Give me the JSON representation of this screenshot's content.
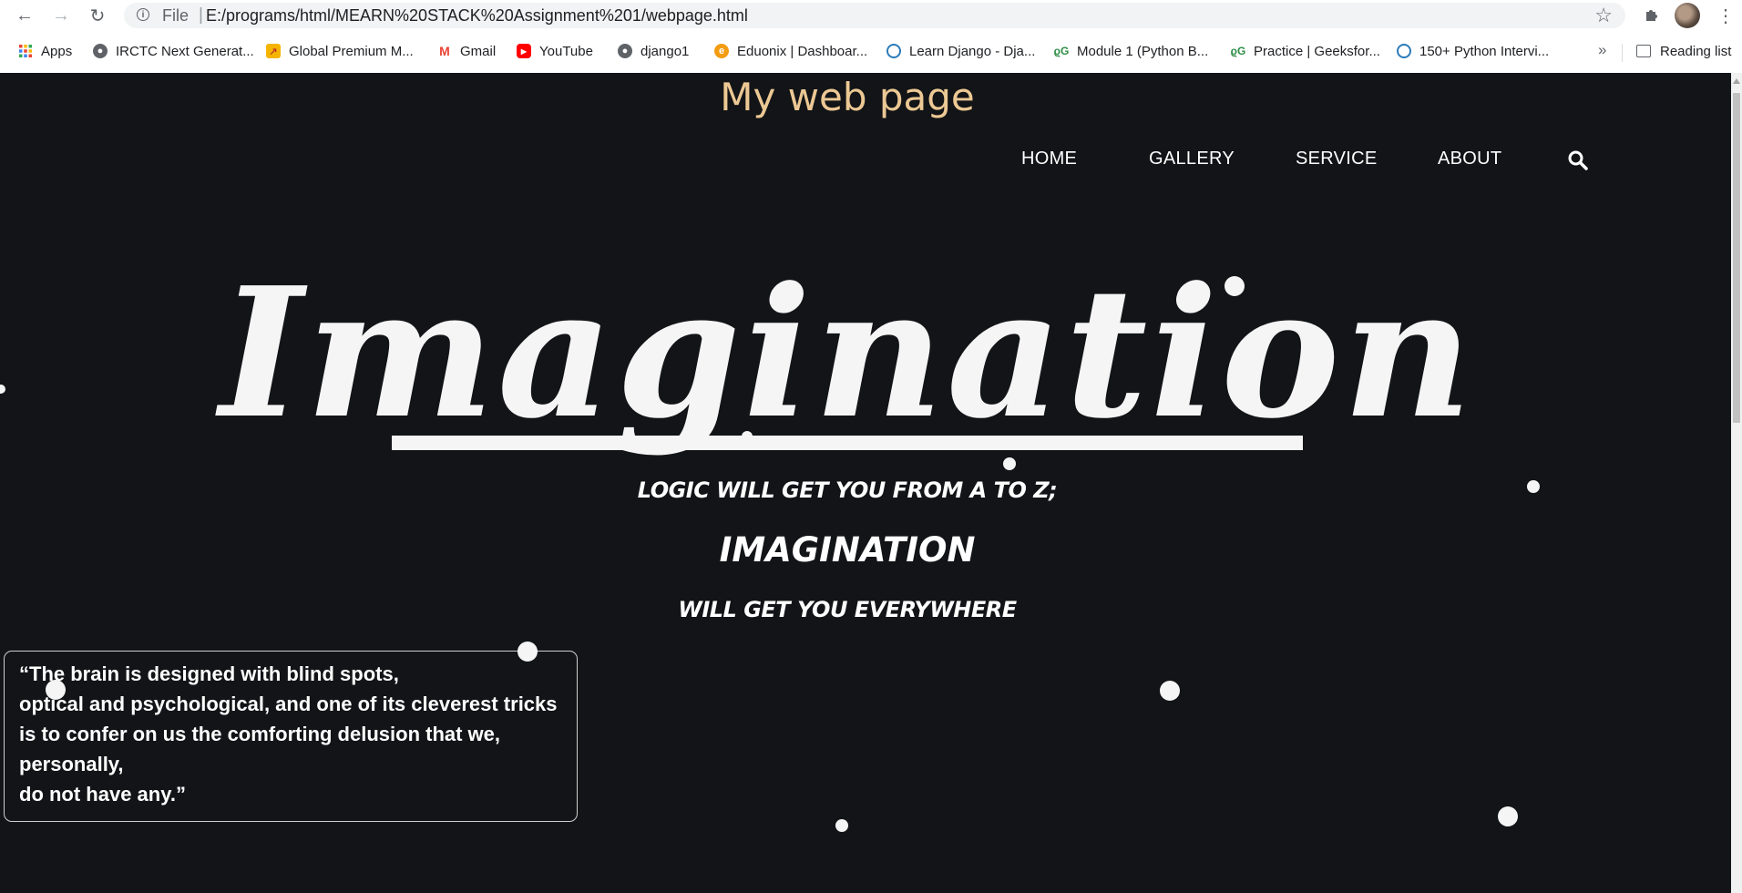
{
  "browser": {
    "file_label": "File",
    "url": "E:/programs/html/MEARN%20STACK%20Assignment%201/webpage.html",
    "bookmarks": [
      {
        "label": "Apps",
        "icon": "apps-grid-icon"
      },
      {
        "label": "IRCTC Next Generat...",
        "icon": "globe-icon"
      },
      {
        "label": "Global Premium M...",
        "icon": "global-premium-icon"
      },
      {
        "label": "Gmail",
        "icon": "gmail-icon"
      },
      {
        "label": "YouTube",
        "icon": "youtube-icon"
      },
      {
        "label": "django1",
        "icon": "globe-icon"
      },
      {
        "label": "Eduonix | Dashboar...",
        "icon": "eduonix-icon"
      },
      {
        "label": "Learn Django - Dja...",
        "icon": "django-icon"
      },
      {
        "label": "Module 1 (Python B...",
        "icon": "geeksforgeeks-icon"
      },
      {
        "label": "Practice | Geeksfor...",
        "icon": "geeksforgeeks-icon"
      },
      {
        "label": "150+ Python Intervi...",
        "icon": "django-icon"
      }
    ],
    "more_label": "»",
    "reading_list": "Reading list"
  },
  "site": {
    "title": "My web page",
    "nav": [
      {
        "label": "HOME"
      },
      {
        "label": "GALLERY"
      },
      {
        "label": "SERVICE"
      },
      {
        "label": "ABOUT"
      }
    ],
    "hero": "Imagination",
    "tagline1": "LOGIC WILL GET YOU FROM A TO Z;",
    "tagline2": "IMAGINATION",
    "tagline3": "WILL GET YOU EVERYWHERE",
    "quote": "“The brain is designed with blind spots,\noptical and psychological, and one of its cleverest tricks is to confer on us the comforting delusion that we, personally,\ndo not have any.”"
  },
  "colors": {
    "page_background": "#121417",
    "title_color": "#ecc894",
    "text_color": "#ffffff"
  }
}
